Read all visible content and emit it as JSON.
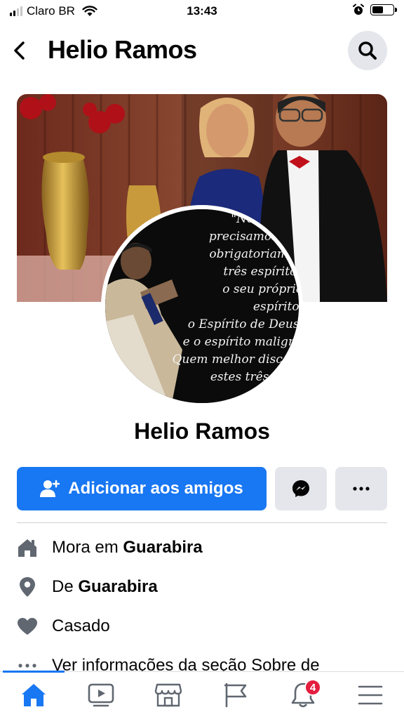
{
  "status_bar": {
    "carrier": "Claro BR",
    "time": "13:43"
  },
  "header": {
    "title": "Helio Ramos"
  },
  "profile": {
    "name": "Helio Ramos",
    "avatar_quote": "\"No cenário\nprecisamos con\nobrigatoriamen\ntrês espíritos\no seu próprio espírito,\no Espírito de Deus,\ne o espírito maligno\nQuem melhor discern\nestes três espír\nserá o ca"
  },
  "actions": {
    "add_friend_label": "Adicionar aos amigos"
  },
  "intro": {
    "lives_in_prefix": "Mora em ",
    "lives_in_city": "Guarabira",
    "from_prefix": "De ",
    "from_city": "Guarabira",
    "relationship": "Casado",
    "see_about": "Ver informações da seção Sobre de"
  },
  "tabbar": {
    "notifications_badge": "4"
  },
  "colors": {
    "accent": "#1877f2",
    "button_grey": "#e4e6eb",
    "badge_red": "#e41e3f",
    "icon_grey": "#606770"
  },
  "icons": [
    "back-arrow-icon",
    "search-icon",
    "add-friend-icon",
    "messenger-icon",
    "more-icon",
    "home-icon",
    "location-pin-icon",
    "heart-icon",
    "ellipsis-icon",
    "watch-icon",
    "marketplace-icon",
    "pages-flag-icon",
    "bell-icon",
    "menu-icon"
  ]
}
